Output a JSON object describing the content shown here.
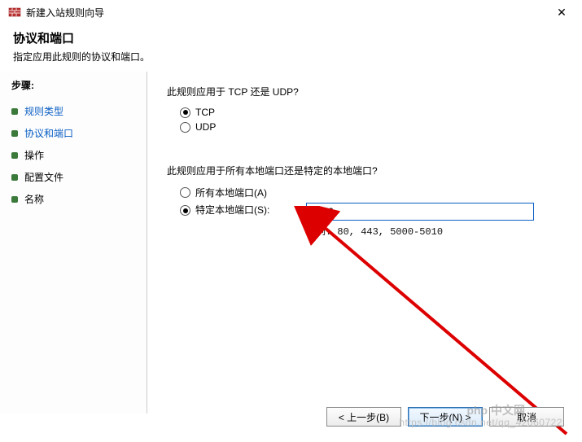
{
  "window": {
    "title": "新建入站规则向导",
    "close": "✕"
  },
  "header": {
    "title": "协议和端口",
    "subtitle": "指定应用此规则的协议和端口。"
  },
  "sidebar": {
    "steps_label": "步骤:",
    "items": [
      {
        "label": "规则类型",
        "active": true
      },
      {
        "label": "协议和端口",
        "active": true
      },
      {
        "label": "操作",
        "active": false
      },
      {
        "label": "配置文件",
        "active": false
      },
      {
        "label": "名称",
        "active": false
      }
    ]
  },
  "content": {
    "q1": "此规则应用于 TCP 还是 UDP?",
    "proto": {
      "tcp": "TCP",
      "udp": "UDP",
      "selected": "tcp"
    },
    "q2": "此规则应用于所有本地端口还是特定的本地端口?",
    "ports": {
      "all_label": "所有本地端口(A)",
      "specific_label": "特定本地端口(S):",
      "selected": "specific",
      "value": "3306",
      "example": "示例: 80, 443, 5000-5010"
    }
  },
  "buttons": {
    "back": "< 上一步(B)",
    "next": "下一步(N) >",
    "cancel": "取消"
  },
  "watermark": "https://blog.csdn.net/qq_42060722",
  "watermark2": "php 中文网"
}
